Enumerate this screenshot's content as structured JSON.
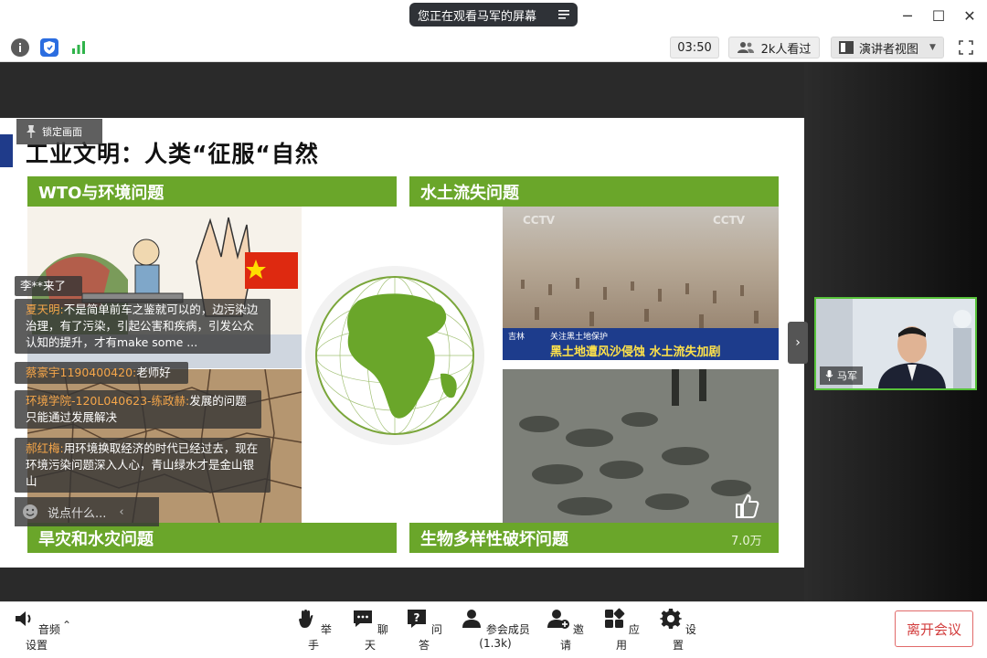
{
  "titlebar": {
    "share_status": "您正在观看马军的屏幕",
    "minimize": "─",
    "maximize": "☐",
    "close": "✕"
  },
  "toolbar": {
    "timer": "03:50",
    "viewers": "2k人看过",
    "view_mode": "演讲者视图",
    "icons": [
      "info-icon",
      "shield-icon",
      "signal-icon",
      "viewers-icon",
      "layout-icon",
      "fullscreen-icon"
    ]
  },
  "slide": {
    "title": "工业文明：人类“征服“自然",
    "sections": {
      "wto": "WTO与环境问题",
      "soil": "水土流失问题",
      "drought": "旱灾和水灾问题",
      "biodiversity": "生物多样性破坏问题"
    },
    "cctv_caption_top": "关注黑土地保护",
    "cctv_caption_main": "黑土地遭风沙侵蚀 水土流失加剧",
    "cctv_logo": "CCTV",
    "province": "吉林",
    "likes": "7.0万"
  },
  "overlay": {
    "lock_label": "锁定画面"
  },
  "chat": {
    "system": "李**来了",
    "messages": [
      {
        "who": "夏天明:",
        "text": "不是简单前车之鉴就可以的，边污染边治理，有了污染，引起公害和疾病，引发公众认知的提升，才有make some ..."
      },
      {
        "who": "蔡豪宇1190400420:",
        "text": "老师好"
      },
      {
        "who": "环境学院-120L040623-练政赫:",
        "text": "发展的问题只能通过发展解决"
      },
      {
        "who": "郝红梅:",
        "text": "用环境换取经济的时代已经过去，现在环境污染问题深入人心，青山绿水才是金山银山"
      }
    ],
    "input_placeholder": "说点什么..."
  },
  "presenter": {
    "name": "马军"
  },
  "bottombar": {
    "audio_settings": "音频设置",
    "items": [
      {
        "label": "举手",
        "icon": "hand-icon"
      },
      {
        "label": "聊天",
        "icon": "chat-icon"
      },
      {
        "label": "问答",
        "icon": "qa-icon"
      },
      {
        "label": "参会成员(1.3k)",
        "icon": "participants-icon"
      },
      {
        "label": "邀请",
        "icon": "invite-icon"
      },
      {
        "label": "应用",
        "icon": "apps-icon"
      },
      {
        "label": "设置",
        "icon": "settings-icon"
      }
    ],
    "leave": "离开会议"
  },
  "colors": {
    "section_green": "#6aa62a",
    "title_bar_blue": "#1f3b8a",
    "leave_red": "#d23c3c",
    "active_border": "#57c23a"
  }
}
